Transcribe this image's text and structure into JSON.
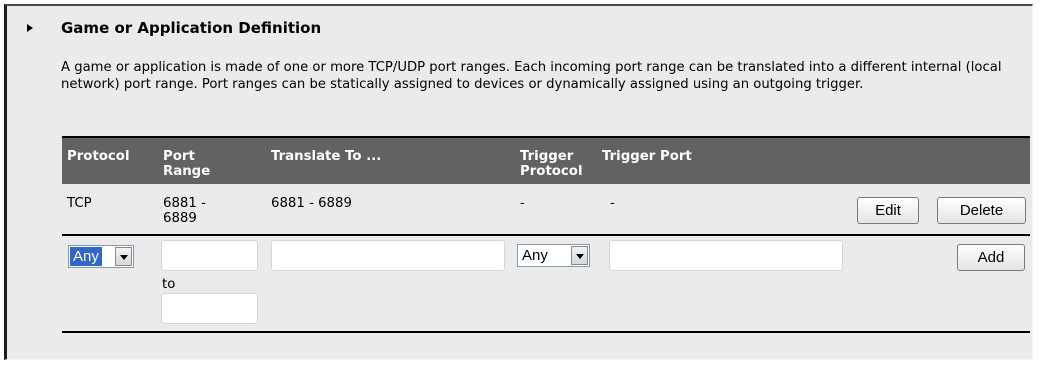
{
  "section": {
    "title": "Game or Application Definition",
    "description": "A game or application is made of one or more TCP/UDP port ranges. Each incoming port range can be translated into a different internal (local network) port range. Port ranges can be statically assigned to devices or dynamically assigned using an outgoing trigger."
  },
  "table": {
    "headers": {
      "protocol": "Protocol",
      "port_range_1": "Port",
      "port_range_2": "Range",
      "translate_to": "Translate To ...",
      "trigger_protocol_1": "Trigger",
      "trigger_protocol_2": "Protocol",
      "trigger_port": "Trigger Port"
    },
    "rows": [
      {
        "protocol": "TCP",
        "port_range_1": "6881 -",
        "port_range_2": "6889",
        "translate_to": "6881 - 6889",
        "trigger_protocol": "-",
        "trigger_port": "-",
        "edit_label": "Edit",
        "delete_label": "Delete"
      }
    ],
    "new_row": {
      "protocol_selected": "Any",
      "port_from_value": "",
      "to_label": "to",
      "port_to_value": "",
      "translate_to_value": "",
      "trigger_protocol_selected": "Any",
      "trigger_port_value": "",
      "add_label": "Add"
    }
  }
}
